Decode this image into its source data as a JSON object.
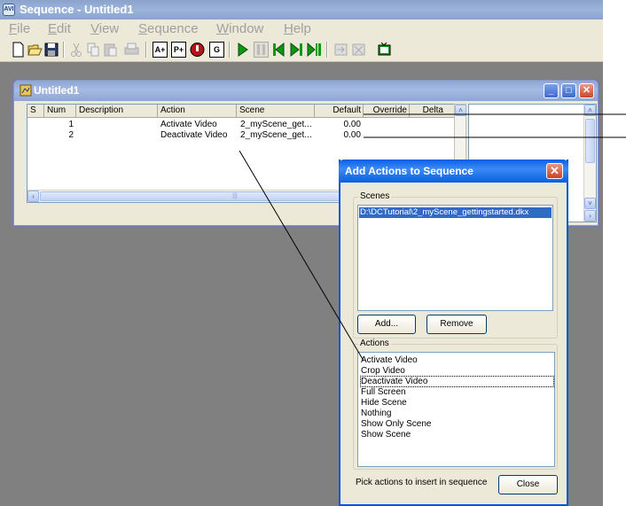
{
  "app": {
    "title": "Sequence - Untitled1",
    "icon_text": "AVI",
    "menu": [
      {
        "label": "File",
        "hotkey": "F",
        "rest": "ile"
      },
      {
        "label": "Edit",
        "hotkey": "E",
        "rest": "dit"
      },
      {
        "label": "View",
        "hotkey": "V",
        "rest": "iew"
      },
      {
        "label": "Sequence",
        "hotkey": "S",
        "rest": "equence"
      },
      {
        "label": "Window",
        "hotkey": "W",
        "rest": "indow"
      },
      {
        "label": "Help",
        "hotkey": "H",
        "rest": "elp"
      }
    ],
    "toolbar": {
      "add_action_label": "A+",
      "add_pause_label": "P+",
      "g_label": "G"
    }
  },
  "child_window": {
    "title": "Untitled1",
    "columns": [
      "S",
      "Num",
      "Description",
      "Action",
      "Scene",
      "Default",
      "Override",
      "Delta"
    ],
    "rows": [
      {
        "s": "",
        "num": "1",
        "description": "",
        "action": "Activate Video",
        "scene": "2_myScene_get...",
        "default": "0.00",
        "override": ""
      },
      {
        "s": "",
        "num": "2",
        "description": "",
        "action": "Deactivate Video",
        "scene": "2_myScene_get...",
        "default": "0.00",
        "override": ""
      }
    ],
    "delta_header_visible": "Delta",
    "hscroll_thumb_grip": "|||"
  },
  "dialog": {
    "title": "Add Actions to Sequence",
    "scenes_group_label": "Scenes",
    "scenes": [
      "D:\\DCTutorial\\2_myScene_gettingstarted.dkx"
    ],
    "add_button": "Add...",
    "remove_button": "Remove",
    "actions_group_label": "Actions",
    "actions": [
      "Activate Video",
      "Crop Video",
      "Deactivate Video",
      "Full Screen",
      "Hide Scene",
      "Nothing",
      "Show Only Scene",
      "Show Scene"
    ],
    "focused_action": "Deactivate Video",
    "hint": "Pick actions to insert in sequence",
    "close_button": "Close"
  },
  "colors": {
    "xp_blue": "#0054e3",
    "selection": "#316ac5",
    "mdi_background": "#808080",
    "dialog_face": "#ece9d8"
  }
}
